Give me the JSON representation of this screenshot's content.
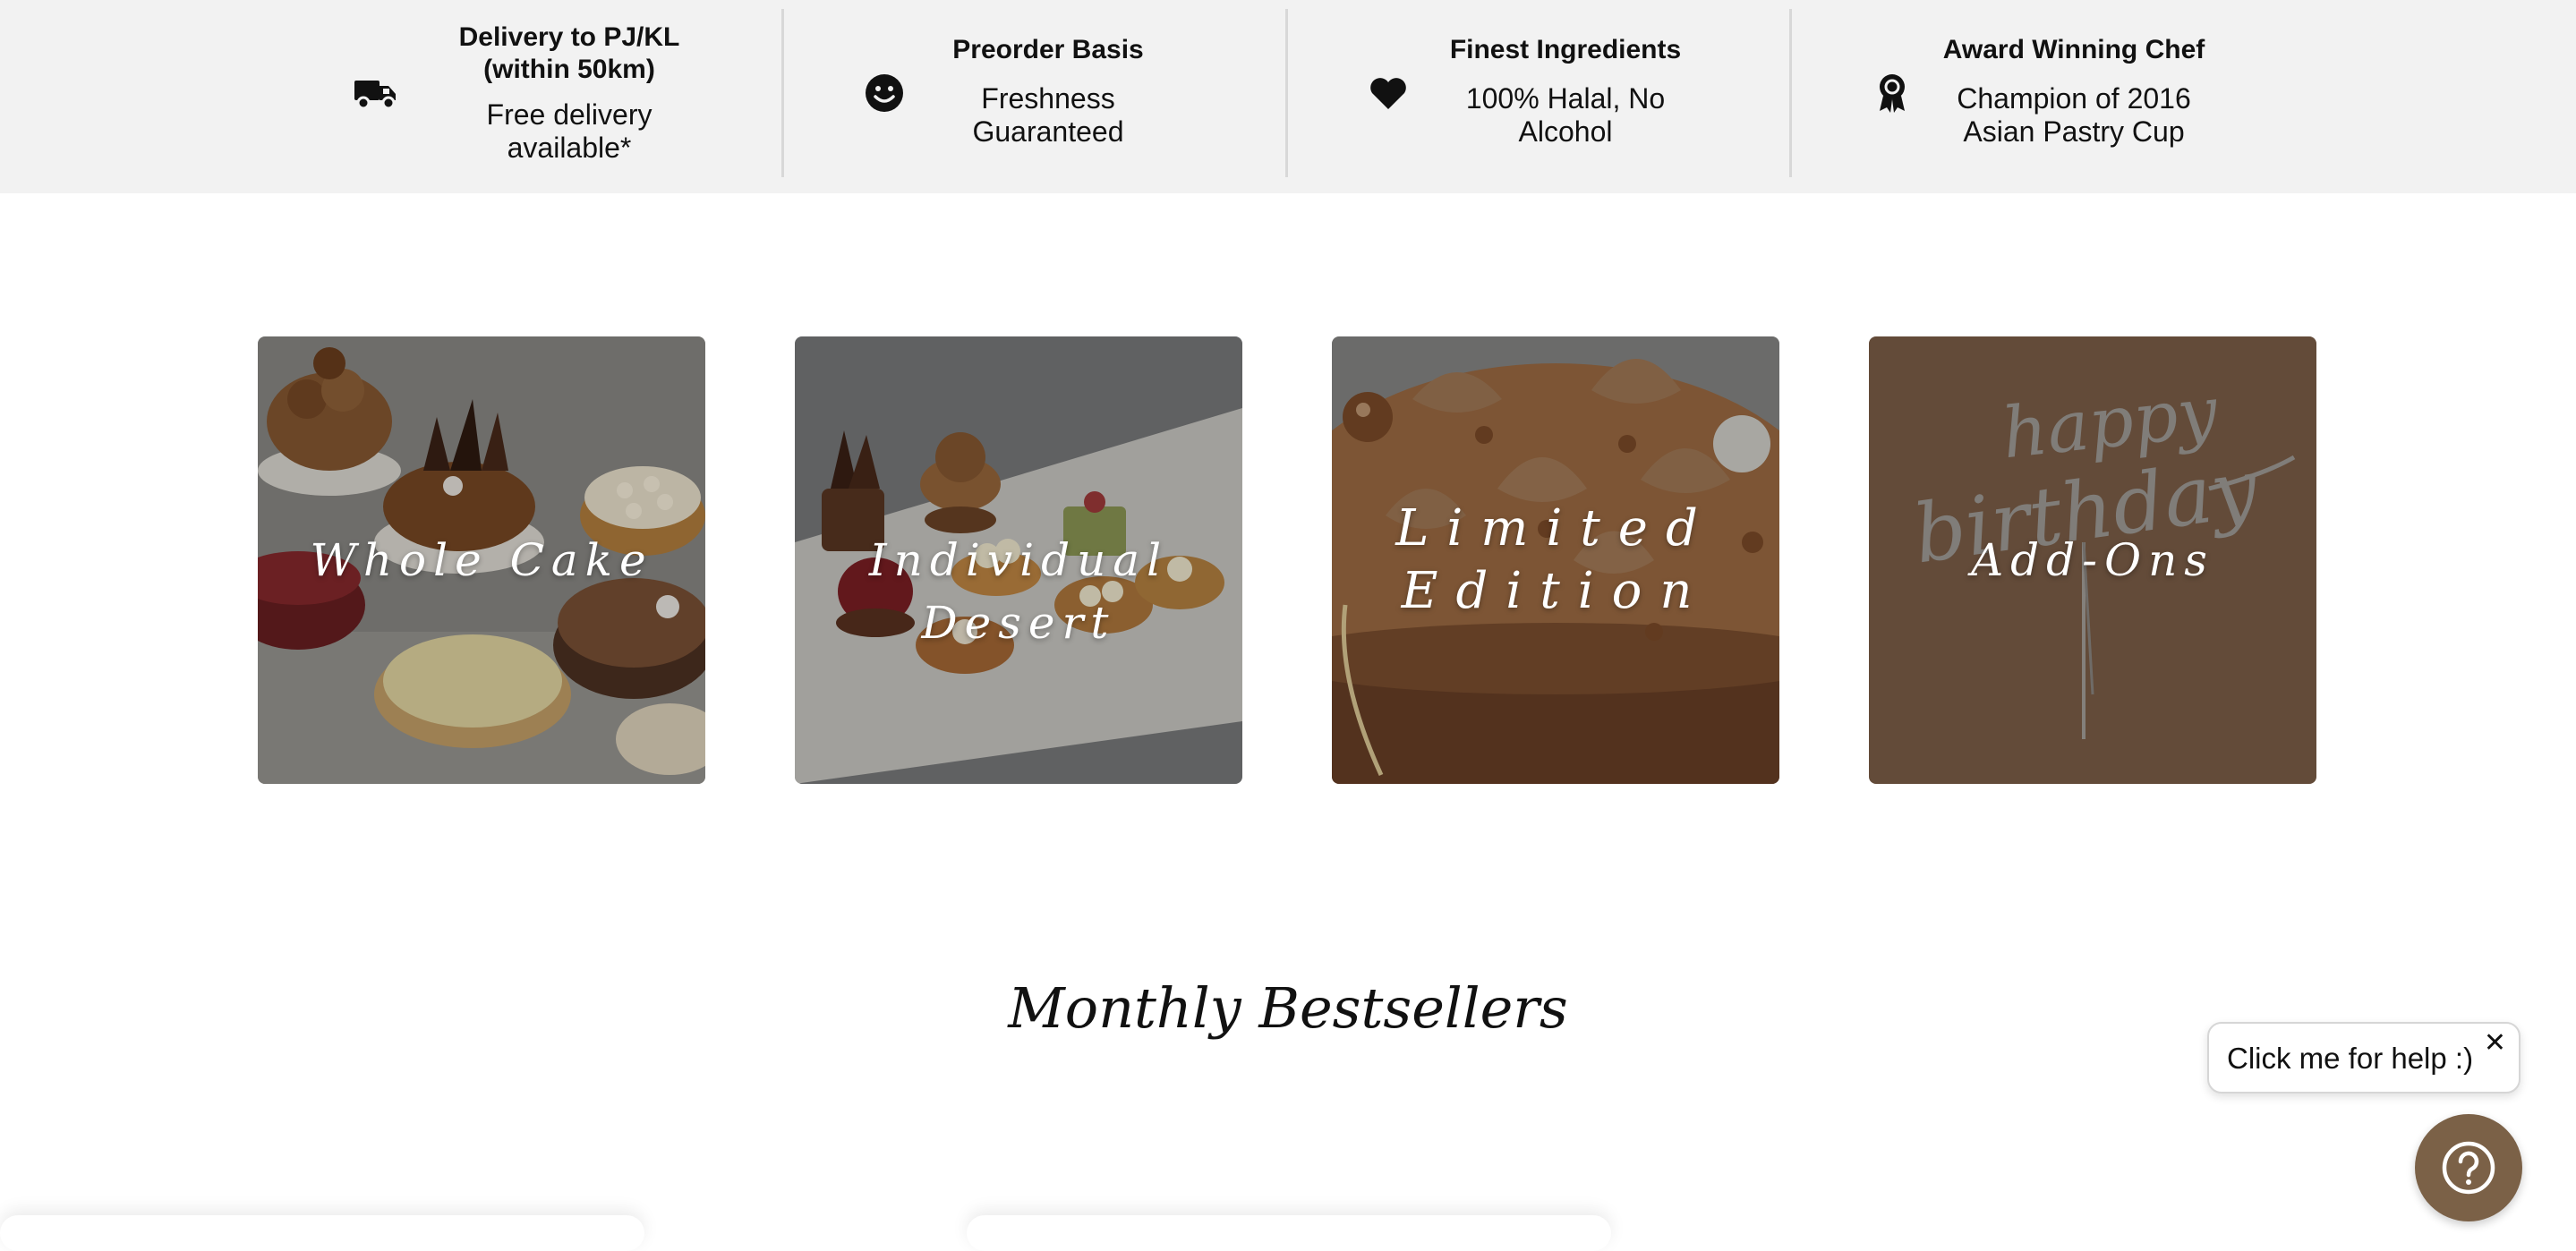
{
  "features": [
    {
      "icon": "truck-icon",
      "title": "Delivery to PJ/KL (within 50km)",
      "title_line1": "Delivery to PJ/KL",
      "title_line2": "(within 50km)",
      "desc_line1": "Free delivery",
      "desc_line2": "available*"
    },
    {
      "icon": "smiley-icon",
      "title_line1": "Preorder Basis",
      "desc_line1": "Freshness",
      "desc_line2": "Guaranteed"
    },
    {
      "icon": "heart-icon",
      "title_line1": "Finest Ingredients",
      "desc_line1": "100% Halal, No",
      "desc_line2": "Alcohol"
    },
    {
      "icon": "award-icon",
      "title_line1": "Award Winning Chef",
      "desc_line1": "Champion of 2016",
      "desc_line2": "Asian Pastry Cup"
    }
  ],
  "categories": [
    {
      "label": "Whole Cake"
    },
    {
      "label": "Individual Desert"
    },
    {
      "label_line1": "Limited",
      "label_line2": "Edition"
    },
    {
      "label": "Add-Ons",
      "topper_text_1": "happy",
      "topper_text_2": "birthday"
    }
  ],
  "section": {
    "title": "Monthly Bestsellers"
  },
  "help": {
    "bubble_text": "Click me for help :)",
    "close_glyph": "✕",
    "button_icon": "question-circle-icon",
    "button_color": "#7b6147"
  },
  "colors": {
    "feature_bar_bg": "#f2f2f2",
    "accent_brown": "#7b6147"
  }
}
